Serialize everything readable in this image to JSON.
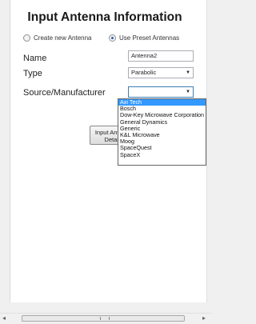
{
  "title": "Input Antenna Information",
  "mode_options": [
    {
      "label": "Create new Antenna",
      "selected": false
    },
    {
      "label": "Use Preset Antennas",
      "selected": true
    }
  ],
  "fields": {
    "name": {
      "label": "Name",
      "value": "Antenna2"
    },
    "type": {
      "label": "Type",
      "value": "Parabolic"
    },
    "source": {
      "label": "Source/Manufacturer",
      "value": ""
    }
  },
  "details_button": {
    "label": "Input Antenna\nDetails"
  },
  "source_options": [
    "Axi Tech",
    "Bosch",
    "Dow-Key Microwave Corporation",
    "General Dynamics",
    "Generic",
    "K&L Microwave",
    "Moog",
    "SpaceQuest",
    "SpaceX"
  ],
  "highlighted_option_index": 0,
  "colors": {
    "highlight": "#3399ff",
    "focus_border": "#3c7fb1"
  },
  "icons": {
    "dropdown": "chevron-down-icon",
    "scroll_left": "arrow-left-icon",
    "scroll_right": "arrow-right-icon"
  }
}
